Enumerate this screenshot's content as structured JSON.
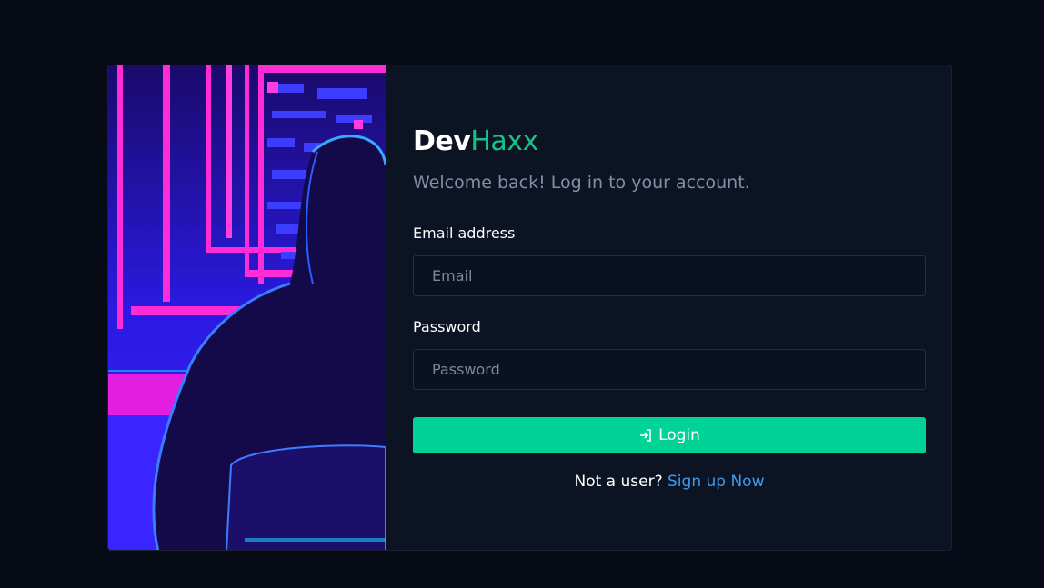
{
  "brand": {
    "part1": "Dev",
    "part2": "Haxx"
  },
  "subtitle": "Welcome back! Log in to your account.",
  "email": {
    "label": "Email address",
    "placeholder": "Email",
    "value": ""
  },
  "password": {
    "label": "Password",
    "placeholder": "Password",
    "value": ""
  },
  "login": {
    "label": "Login",
    "icon": "login-arrow-icon"
  },
  "signup": {
    "prompt": "Not a user?",
    "link": "Sign up Now"
  },
  "colors": {
    "accent": "#00d395",
    "brand_accent": "#19c08a",
    "link": "#3d9cf2",
    "background": "#060b16",
    "card": "#0c1424"
  },
  "hero": {
    "icon": "hacker-illustration"
  }
}
